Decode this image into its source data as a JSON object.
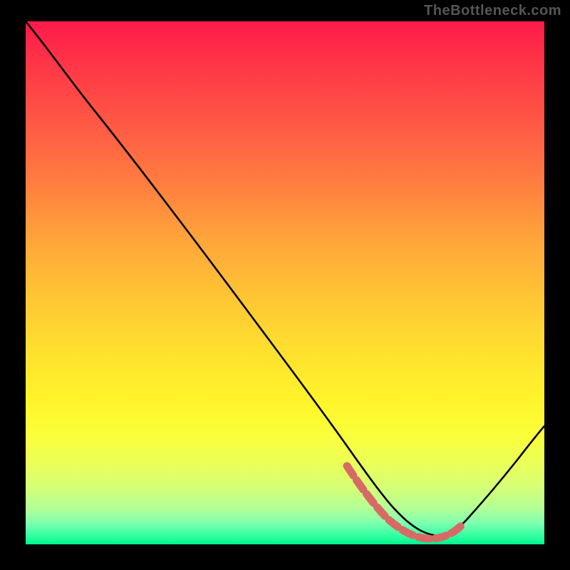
{
  "watermark": "TheBottleneck.com",
  "chart_data": {
    "type": "line",
    "title": "",
    "xlabel": "",
    "ylabel": "",
    "xlim": [
      0,
      100
    ],
    "ylim": [
      0,
      100
    ],
    "series": [
      {
        "name": "curve",
        "color": "#000000",
        "x": [
          0,
          5,
          14,
          24,
          34,
          44,
          54,
          62,
          66,
          69,
          72,
          75,
          78,
          81,
          84,
          87,
          90,
          93,
          96,
          100
        ],
        "values": [
          100,
          94,
          82,
          68,
          55,
          41,
          27,
          15,
          10,
          7.5,
          5.8,
          4.6,
          4,
          4.2,
          4.8,
          6,
          8,
          11,
          15,
          21
        ]
      },
      {
        "name": "highlight",
        "color": "#d86a66",
        "x": [
          62,
          66,
          69,
          72,
          75,
          78,
          81,
          84
        ],
        "values": [
          15,
          10,
          7.5,
          5.8,
          4.6,
          4,
          4.2,
          4.8
        ]
      }
    ],
    "background_gradient": {
      "top": "#ff1a4a",
      "mid": "#ffe22e",
      "bottom": "#00f58a"
    }
  }
}
